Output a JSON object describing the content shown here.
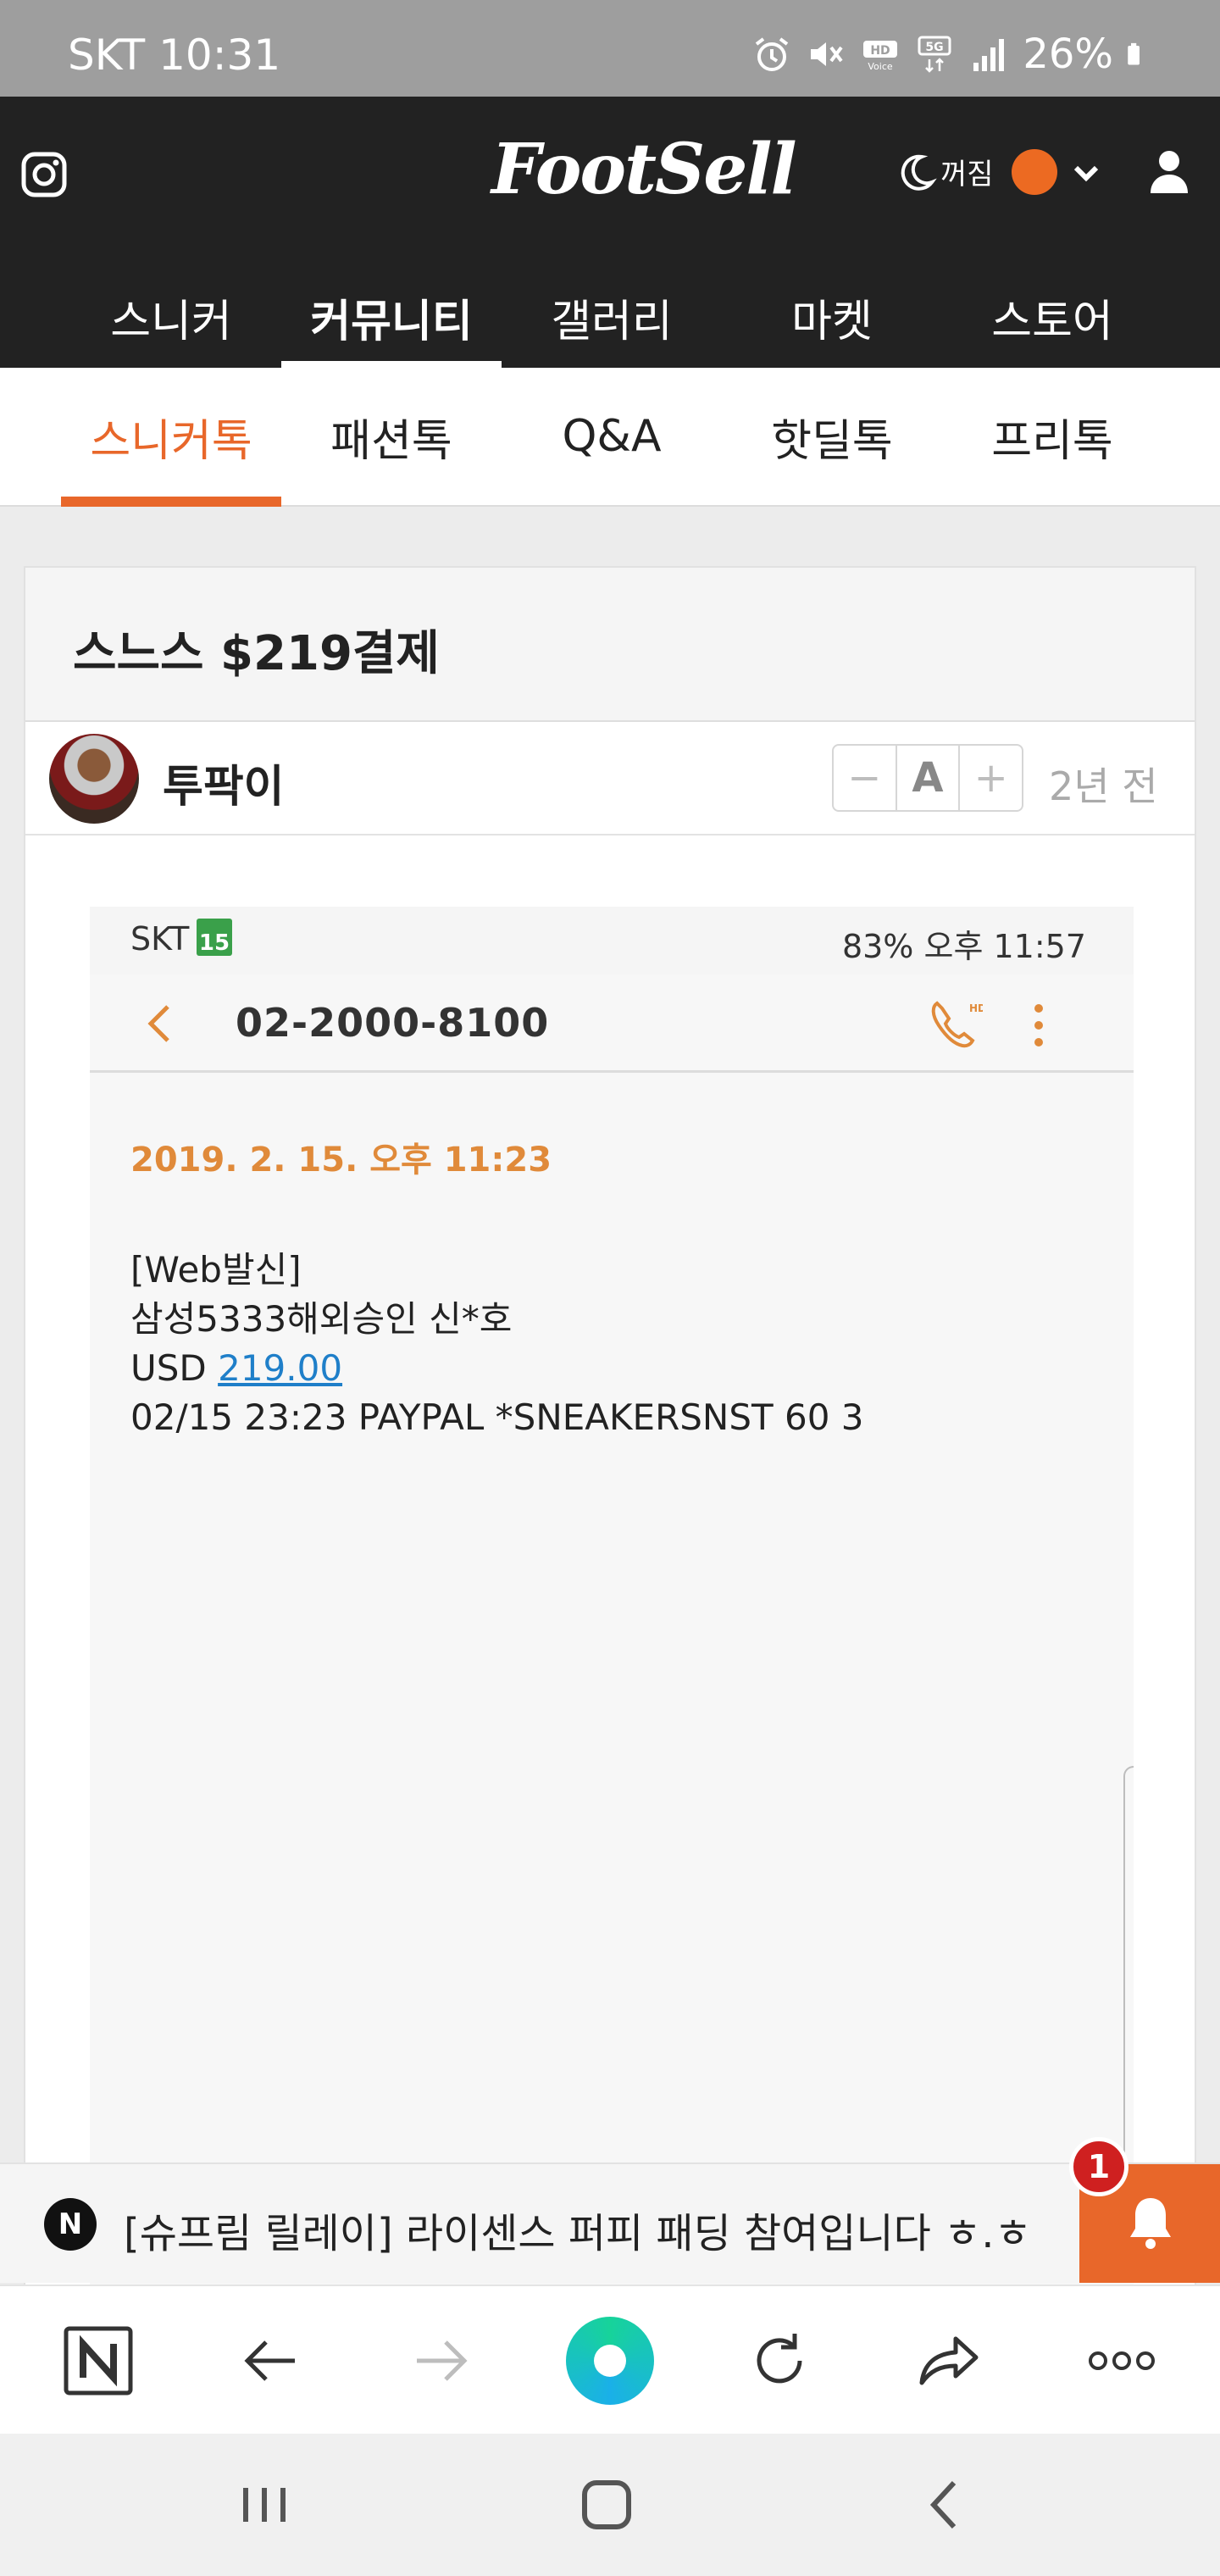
{
  "status_bar": {
    "carrier_time": "SKT 10:31",
    "battery": "26%"
  },
  "header": {
    "logo": "FootSell",
    "night_mode_label": "꺼짐",
    "main_nav": [
      {
        "label": "스니커",
        "active": false
      },
      {
        "label": "커뮤니티",
        "active": true
      },
      {
        "label": "갤러리",
        "active": false
      },
      {
        "label": "마켓",
        "active": false
      },
      {
        "label": "스토어",
        "active": false
      }
    ]
  },
  "sub_nav": [
    {
      "label": "스니커톡",
      "active": true
    },
    {
      "label": "패션톡",
      "active": false
    },
    {
      "label": "Q&A",
      "active": false
    },
    {
      "label": "핫딜톡",
      "active": false
    },
    {
      "label": "프리톡",
      "active": false
    }
  ],
  "post": {
    "title": "스느스 $219결제",
    "author": "투팍이",
    "font_controls": {
      "decrease": "−",
      "reset": "A",
      "increase": "+"
    },
    "time_ago": "2년 전"
  },
  "embedded_screenshot": {
    "status_left": "SKT",
    "date_badge": "15",
    "status_right": "83% 오후 11:57",
    "phone_number": "02-2000-8100",
    "message_date": "2019. 2. 15. 오후 11:23",
    "message_line1": "[Web발신]",
    "message_line2": "삼성5333해외승인 신*호",
    "message_line3_prefix": "USD ",
    "message_line3_amount": "219.00",
    "message_line4": "02/15 23:23 PAYPAL *SNEAKERSNST 60 3"
  },
  "notification": {
    "logo_letter": "N",
    "text": "[슈프림 릴레이] 라이센스 퍼피 패딩 참여입니다 ㅎ.ㅎ",
    "badge_count": "1"
  },
  "browser_toolbar": {
    "home_letter": "N"
  },
  "colors": {
    "accent": "#e8672a",
    "header_bg": "#222222",
    "badge": "#cf2020",
    "link": "#1f7fc9"
  }
}
